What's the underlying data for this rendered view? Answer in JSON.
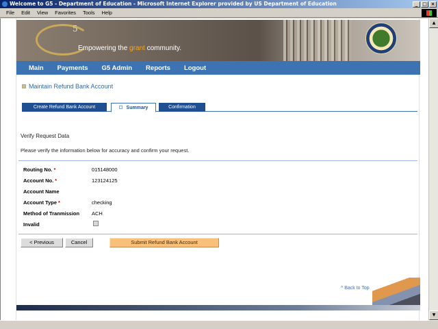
{
  "window": {
    "title": "Welcome to G5 - Department of Education - Microsoft Internet Explorer provided by US Department of Education",
    "controls": {
      "minimize": "_",
      "maximize": "□",
      "close": "×"
    }
  },
  "menu": [
    "File",
    "Edit",
    "View",
    "Favorites",
    "Tools",
    "Help"
  ],
  "banner": {
    "logo_sup": "5",
    "tagline_pre": "Empowering the ",
    "tagline_hl": "grant",
    "tagline_post": " community."
  },
  "nav": [
    "Main",
    "Payments",
    "G5 Admin",
    "Reports",
    "Logout"
  ],
  "page_title": "Maintain Refund Bank Account",
  "tabs": [
    {
      "label": "Create Refund Bank Account",
      "active": false
    },
    {
      "label": "Summary",
      "active": true
    },
    {
      "label": "Confirmation",
      "active": false
    }
  ],
  "verify_heading": "Verify Request Data",
  "verify_instructions": "Please verify the information below for accuracy and confirm your request.",
  "fields": [
    {
      "label": "Routing No.",
      "required": true,
      "value": "015148000"
    },
    {
      "label": "Account No.",
      "required": true,
      "value": "123124125"
    },
    {
      "label": "Account Name",
      "required": false,
      "value": ""
    },
    {
      "label": "Account Type",
      "required": true,
      "value": "checking"
    },
    {
      "label": "Method of Tranmission",
      "required": false,
      "value": "ACH"
    },
    {
      "label": "Invalid",
      "required": false,
      "value": ""
    }
  ],
  "required_marker": "*",
  "buttons": {
    "previous": "< Previous",
    "cancel": "Cancel",
    "submit": "Submit Refund Bank Account"
  },
  "back_to_top": "^ Back to Top",
  "colors": {
    "nav": "#3d72b3",
    "tab": "#1f4e91",
    "submit": "#f9c07a",
    "required": "#cc0000"
  }
}
